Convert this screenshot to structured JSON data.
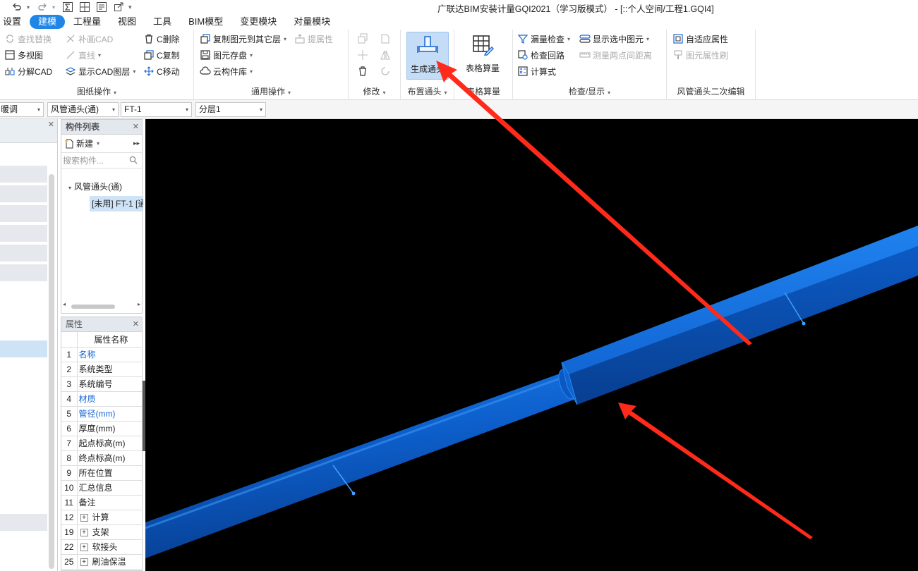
{
  "window": {
    "title": "广联达BIM安装计量GQI2021（学习版模式） - [::个人空间/工程1.GQI4]"
  },
  "quick_access": [
    "undo-icon",
    "redo-icon",
    "sum-icon",
    "grid-icon",
    "panel-icon",
    "export-icon"
  ],
  "menu": {
    "items": [
      "设置",
      "建模",
      "工程量",
      "视图",
      "工具",
      "BIM模型",
      "变更模块",
      "对量模块"
    ],
    "active": "建模"
  },
  "ribbon": {
    "drawing_ops": {
      "label": "图纸操作",
      "find_replace": "查找替换",
      "patch_cad": "补画CAD",
      "c_delete": "C删除",
      "multi_view": "多视图",
      "straight_line": "直线",
      "c_copy": "C复制",
      "explode_cad": "分解CAD",
      "show_cad_layer": "显示CAD图层",
      "c_move": "C移动"
    },
    "general_ops": {
      "label": "通用操作",
      "copy_to_other_floor": "复制图元到其它层",
      "extract_props": "提属性",
      "element_save": "图元存盘",
      "cloud_library": "云构件库"
    },
    "modify": {
      "label": "修改"
    },
    "place_fitting": {
      "label": "布置通头",
      "generate_fitting": "生成通头"
    },
    "table_calc": {
      "label": "表格算量",
      "button": "表格算量"
    },
    "check_display": {
      "label": "检查/显示",
      "leak_check": "漏量检查",
      "show_selected": "显示选中图元",
      "check_loop": "检查回路",
      "measure_distance": "测量两点间距离",
      "formula": "计算式"
    },
    "duct_fitting_edit": {
      "label": "风管通头二次编辑",
      "adaptive_props": "自适应属性",
      "element_brush": "图元属性刷"
    }
  },
  "combobar": {
    "c1": "暖调",
    "c2": "风管通头(通)",
    "c3": "FT-1",
    "c4": "分层1"
  },
  "component_list": {
    "title": "构件列表",
    "new_label": "新建",
    "search_placeholder": "搜索构件...",
    "tree_parent": "风管通头(通)",
    "tree_child": "[未用] FT-1 [通"
  },
  "properties": {
    "title": "属性",
    "header": "属性名称",
    "rows": [
      {
        "n": "1",
        "name": "名称",
        "blue": true
      },
      {
        "n": "2",
        "name": "系统类型",
        "blue": false
      },
      {
        "n": "3",
        "name": "系统编号",
        "blue": false
      },
      {
        "n": "4",
        "name": "材质",
        "blue": true
      },
      {
        "n": "5",
        "name": "管径(mm)",
        "blue": true
      },
      {
        "n": "6",
        "name": "厚度(mm)",
        "blue": false
      },
      {
        "n": "7",
        "name": "起点标高(m)",
        "blue": false
      },
      {
        "n": "8",
        "name": "终点标高(m)",
        "blue": false
      },
      {
        "n": "9",
        "name": "所在位置",
        "blue": false
      },
      {
        "n": "10",
        "name": "汇总信息",
        "blue": false
      },
      {
        "n": "11",
        "name": "备注",
        "blue": false
      },
      {
        "n": "12",
        "name": "计算",
        "blue": false,
        "expand": true
      },
      {
        "n": "19",
        "name": "支架",
        "blue": false,
        "expand": true
      },
      {
        "n": "22",
        "name": "软接头",
        "blue": false,
        "expand": true
      },
      {
        "n": "25",
        "name": "刷油保温",
        "blue": false,
        "expand": true
      }
    ]
  },
  "colors": {
    "accent": "#1f86e8",
    "duct_blue": "#0a5cc4",
    "annotation_red": "#ff2a1a",
    "canvas_bg": "#000000"
  }
}
